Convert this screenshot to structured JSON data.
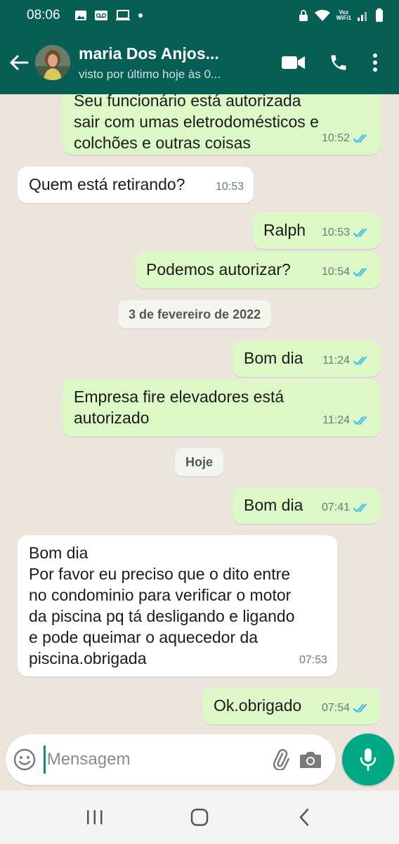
{
  "status_bar": {
    "time": "08:06",
    "voz_line1": "Voz",
    "voz_line2": "WiFi1"
  },
  "header": {
    "contact_name": "maria Dos Anjos...",
    "last_seen": "visto por último hoje às 0..."
  },
  "messages": [
    {
      "dir": "out",
      "text": "Seu funcionário  está autorizada\nsair com umas eletrodomésticos e\ncolchões e outras coisas",
      "time": "10:52",
      "read": true
    },
    {
      "dir": "in",
      "text": "Quem está retirando?",
      "time": "10:53"
    },
    {
      "dir": "out",
      "text": "Ralph",
      "time": "10:53",
      "read": true
    },
    {
      "dir": "out",
      "text": "Podemos  autorizar?",
      "time": "10:54",
      "read": true
    },
    {
      "dir": "date",
      "text": "3 de fevereiro de 2022"
    },
    {
      "dir": "out",
      "text": "Bom dia",
      "time": "11:24",
      "read": true
    },
    {
      "dir": "out",
      "text": "Empresa fire elevadores está\nautorizado",
      "time": "11:24",
      "read": true
    },
    {
      "dir": "date",
      "text": "Hoje"
    },
    {
      "dir": "out",
      "text": "Bom dia",
      "time": "07:41",
      "read": true
    },
    {
      "dir": "in",
      "text": "Bom dia\nPor favor eu preciso  que o dito entre\nno condominio para verificar o motor\nda piscina pq tá desligando e ligando\ne pode queimar o aquecedor da\npiscina.obrigada",
      "time": "07:53"
    },
    {
      "dir": "out",
      "text": "Ok.obrigado",
      "time": "07:54",
      "read": true
    }
  ],
  "composer": {
    "placeholder": "Mensagem"
  },
  "colors": {
    "header": "#075E54",
    "outgoing_bubble": "#DCF8C6",
    "incoming_bubble": "#FFFFFF",
    "mic_button": "#00A884",
    "read_tick": "#34B7F1"
  }
}
